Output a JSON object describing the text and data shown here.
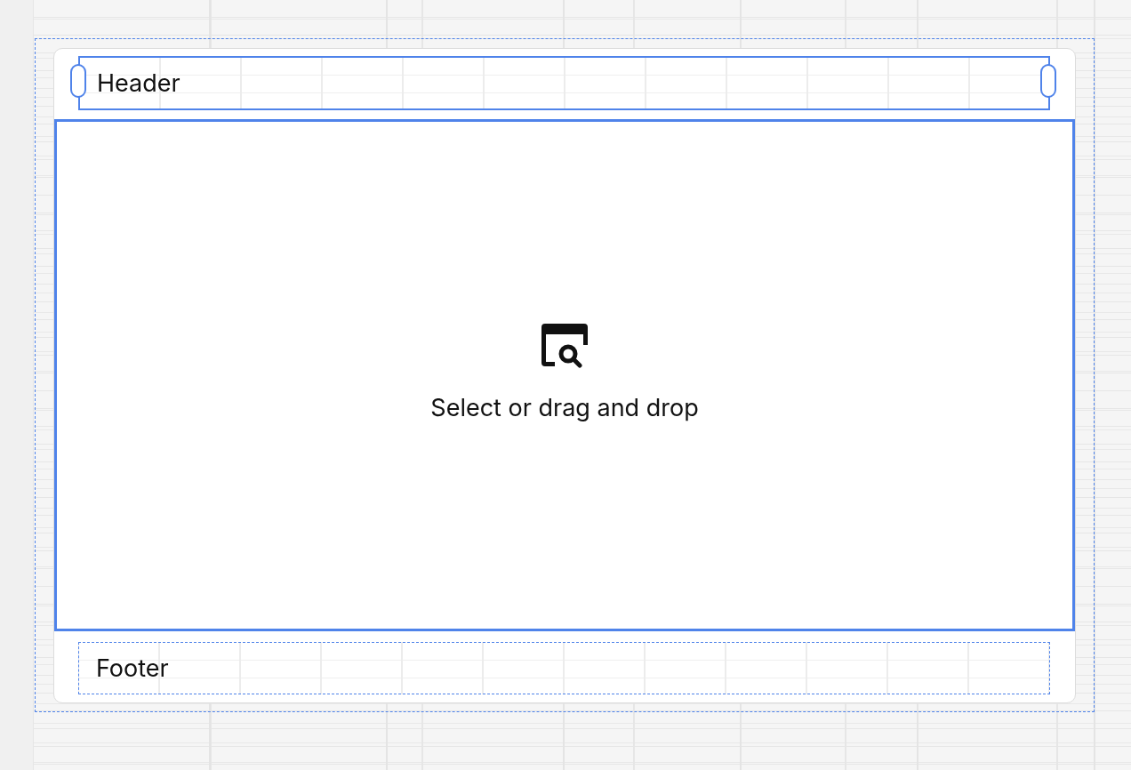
{
  "header": {
    "label": "Header",
    "selected": true
  },
  "drop_zone": {
    "text": "Select or drag and drop",
    "selected": true
  },
  "footer": {
    "label": "Footer",
    "selected": false
  }
}
